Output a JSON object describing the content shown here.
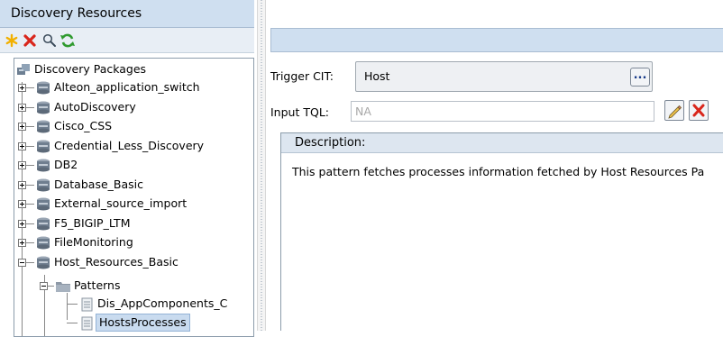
{
  "left_panel": {
    "title": "Discovery Resources",
    "toolbar": {
      "new_icon": "asterisk-new-icon",
      "delete_icon": "red-x-delete-icon",
      "search_icon": "magnifier-search-icon",
      "refresh_icon": "green-refresh-icon"
    },
    "tree": {
      "root_label": "Discovery Packages",
      "packages": [
        "Alteon_application_switch",
        "AutoDiscovery",
        "Cisco_CSS",
        "Credential_Less_Discovery",
        "DB2",
        "Database_Basic",
        "External_source_import",
        "F5_BIGIP_LTM",
        "FileMonitoring",
        "Host_Resources_Basic"
      ],
      "folder_label": "Patterns",
      "patterns": [
        "Dis_AppComponents_C",
        "HostsProcesses"
      ],
      "selected": "HostsProcesses"
    }
  },
  "right_panel": {
    "trigger_cit": {
      "label": "Trigger CIT:",
      "value": "Host",
      "browse_label": "..."
    },
    "input_tql": {
      "label": "Input TQL:",
      "placeholder": "NA"
    },
    "description": {
      "title": "Description:",
      "text": "This pattern fetches processes information fetched by Host Resources Pa"
    }
  },
  "colors": {
    "header_bg": "#cfdff0",
    "selection_bg": "#c9dbef",
    "delete_red": "#d9261c",
    "refresh_green": "#2f9a2f",
    "new_yellow": "#f2b000"
  }
}
